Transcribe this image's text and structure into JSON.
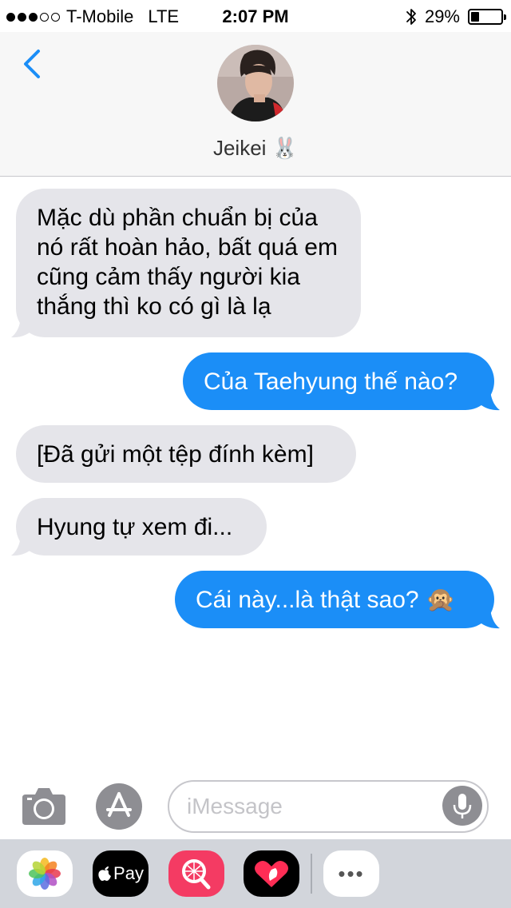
{
  "status_bar": {
    "carrier": "T-Mobile",
    "network": "LTE",
    "time": "2:07 PM",
    "battery": "29%",
    "battery_level": 0.29
  },
  "header": {
    "contact_name": "Jeikei 🐰"
  },
  "messages": [
    {
      "direction": "incoming",
      "text": "Mặc dù phần chuẩn bị của nó rất hoàn hảo, bất quá em cũng cảm thấy người kia thắng thì ko có gì là lạ"
    },
    {
      "direction": "outgoing",
      "text": "Của Taehyung thế nào?"
    },
    {
      "direction": "incoming",
      "text": "[Đã gửi một tệp đính kèm]"
    },
    {
      "direction": "incoming",
      "text": "Hyung tự xem đi..."
    },
    {
      "direction": "outgoing",
      "text": "Cái này...là thật sao? 🙊"
    }
  ],
  "input": {
    "placeholder": "iMessage",
    "value": ""
  },
  "app_drawer": {
    "apple_pay_label": "Pay",
    "more_label": "•••"
  }
}
